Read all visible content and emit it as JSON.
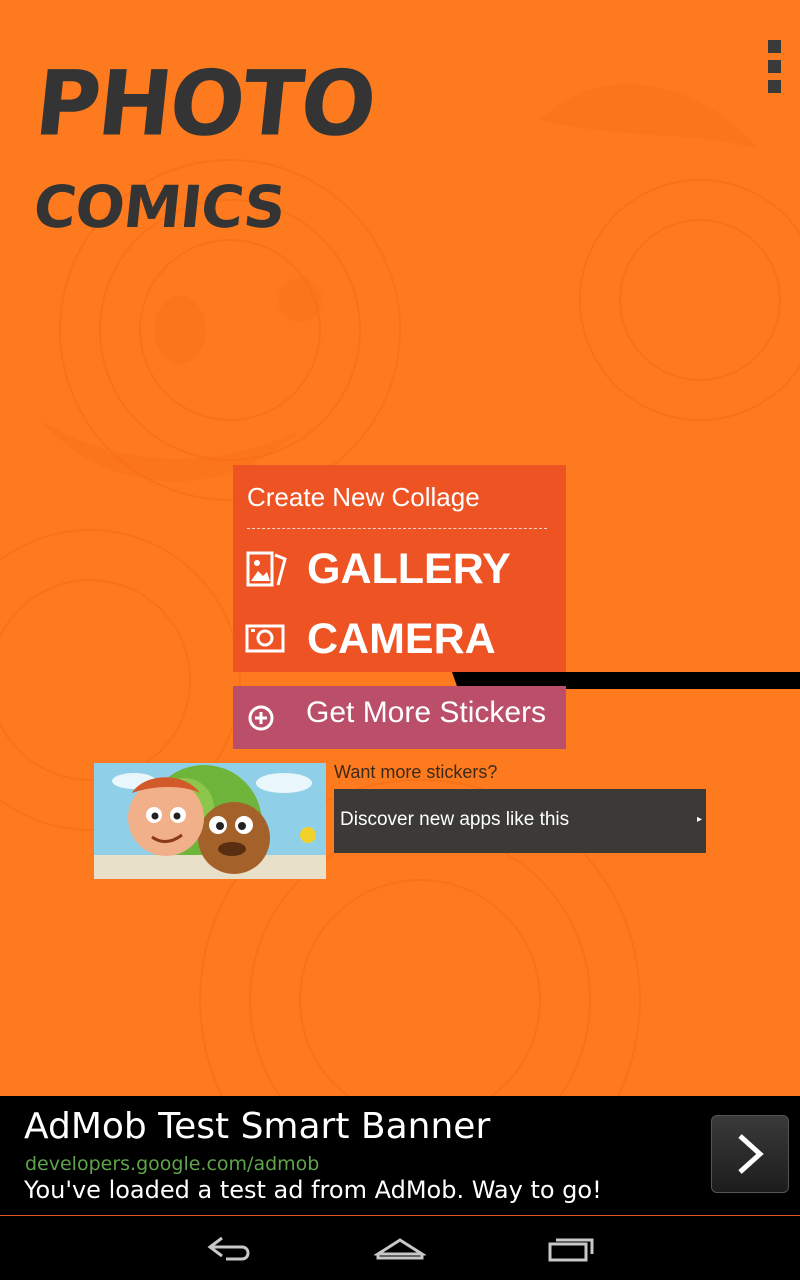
{
  "app": {
    "logo_line1": "PHOTO",
    "logo_line2": "COMICS"
  },
  "overflow_menu_icon": "overflow-menu-icon",
  "collage_card": {
    "title": "Create New Collage",
    "gallery_label": "GALLERY",
    "camera_label": "CAMERA",
    "gallery_icon": "gallery-icon",
    "camera_icon": "camera-icon"
  },
  "stickers_button": {
    "label": "Get More Stickers",
    "icon": "plus-circle-icon"
  },
  "promo": {
    "question": "Want more stickers?",
    "button_label": "Discover new apps like this",
    "arrow": "▸"
  },
  "ad": {
    "title": "AdMob Test Smart Banner",
    "url": "developers.google.com/admob",
    "text": "You've loaded a test ad from AdMob. Way to go!"
  },
  "navbar": {
    "back_icon": "back-icon",
    "home_icon": "home-icon",
    "recents_icon": "recents-icon"
  },
  "colors": {
    "background": "#fd7a1f",
    "card": "#ee5324",
    "stickers_button": "#bb4e68",
    "promo_button": "#3b3a36",
    "logo_text": "#343434",
    "ad_url": "#5fa44a"
  }
}
